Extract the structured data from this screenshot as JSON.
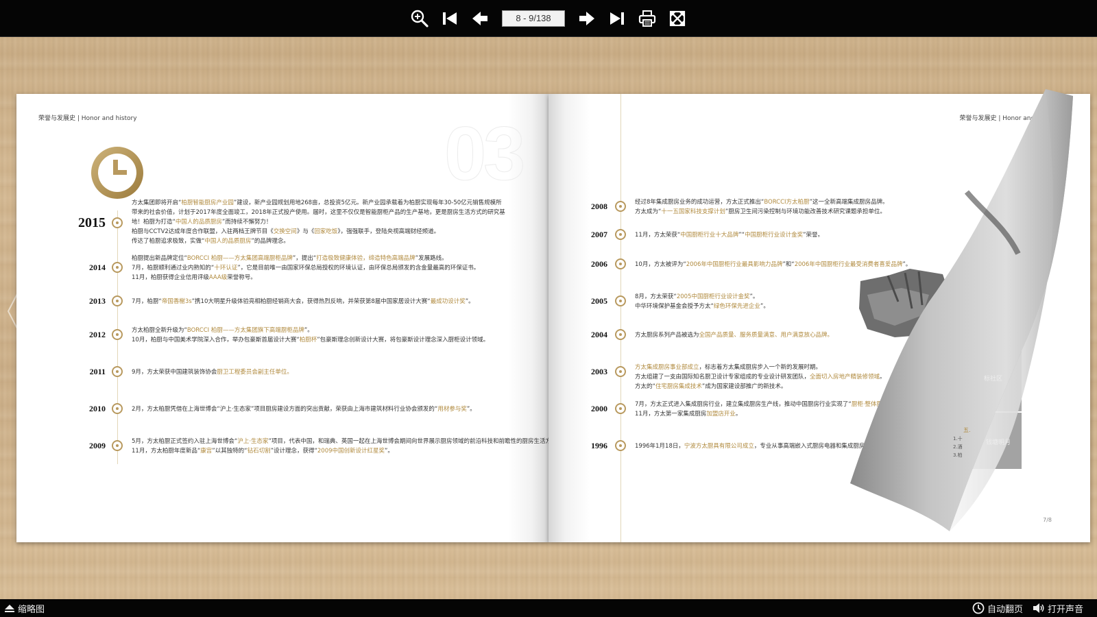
{
  "toolbar": {
    "page_indicator": "8 - 9/138",
    "icons": [
      "zoom-in-icon",
      "first-page-icon",
      "prev-page-icon",
      "next-page-icon",
      "last-page-icon",
      "print-icon",
      "fullscreen-icon"
    ]
  },
  "left_page": {
    "running_head": "荣誉与发展史 | Honor and history",
    "watermark": "03",
    "entries": [
      {
        "year": "2015",
        "lines": [
          [
            {
              "t": "方太集团即将开启“"
            },
            {
              "t": "柏厨智能厨房产业园",
              "g": true
            },
            {
              "t": "”建设，新产业园规划用地268亩，总投资5亿元。新产业园承载着为柏厨实现每年30-50亿元销售规模所"
            }
          ],
          [
            {
              "t": "带来的社会价值，计划于2017年度全面竣工，2018年正式投产使用。届时，这里不仅仅是智能厨柜产品的生产基地，更是厨房生活方式的研究基"
            }
          ],
          [
            {
              "t": "地！柏厨为打造“"
            },
            {
              "t": "中国人的品质厨房",
              "g": true
            },
            {
              "t": "”而持续不懈努力！"
            }
          ],
          [
            {
              "t": "柏厨与CCTV2达成年度合作联盟，入驻两档王牌节目《"
            },
            {
              "t": "交换空间",
              "g": true
            },
            {
              "t": "》与《"
            },
            {
              "t": "回家吃饭",
              "g": true
            },
            {
              "t": "》，强强联手，登陆央视高端财经频道。"
            }
          ],
          [
            {
              "t": "传达了柏厨追求极致，实做“"
            },
            {
              "t": "中国人的品质厨房",
              "g": true
            },
            {
              "t": "”的品牌理念。"
            }
          ]
        ]
      },
      {
        "year": "2014",
        "lines": [
          [
            {
              "t": "柏厨提出新品牌定位“"
            },
            {
              "t": "BORCCI 柏厨——方太集团高端厨柜品牌",
              "g": true
            },
            {
              "t": "”，提出“"
            },
            {
              "t": "打造极致健康体验，缔造特色高端品牌",
              "g": true
            },
            {
              "t": "”发展路线。"
            }
          ],
          [
            {
              "t": "7月，柏厨顺利通过业内熟知的“"
            },
            {
              "t": "十环认证",
              "g": true
            },
            {
              "t": "”，它是目前唯一由国家环保总局授权的环境认证，由环保总局颁发的含金量最高的环保证书。"
            }
          ],
          [
            {
              "t": "11月，柏厨获得企业信用评级"
            },
            {
              "t": "AAA级",
              "g": true
            },
            {
              "t": "荣誉称号。"
            }
          ]
        ]
      },
      {
        "year": "2013",
        "lines": [
          [
            {
              "t": "7月，柏厨“"
            },
            {
              "t": "帝国香榭3s",
              "g": true
            },
            {
              "t": "”携10大明星升级体验亮相柏厨经销商大会，获得热烈反响，并荣获第8届中国家居设计大赛“"
            },
            {
              "t": "最成功设计奖",
              "g": true
            },
            {
              "t": "”。"
            }
          ]
        ]
      },
      {
        "year": "2012",
        "lines": [
          [
            {
              "t": "方太柏厨全新升级为“"
            },
            {
              "t": "BORCCI 柏厨——方太集团旗下高端厨柜品牌",
              "g": true
            },
            {
              "t": "”。"
            }
          ],
          [
            {
              "t": "10月，柏厨与中国美术学院深入合作，举办包豪斯首届设计大赛“"
            },
            {
              "t": "柏厨杯",
              "g": true
            },
            {
              "t": "”包豪斯理念创新设计大赛，将包豪斯设计理念深入厨柜设计领域。"
            }
          ]
        ]
      },
      {
        "year": "2011",
        "lines": [
          [
            {
              "t": "9月，方太荣获中国建筑装饰协会"
            },
            {
              "t": "厨卫工程委员会副主任单位。",
              "g": true
            }
          ]
        ]
      },
      {
        "year": "2010",
        "lines": [
          [
            {
              "t": "2月，方太柏厨凭借在上海世博会“沪上·生态家”项目厨房建设方面的突出贡献，荣获由上海市建筑材料行业协会颁发的“"
            },
            {
              "t": "用材参与奖",
              "g": true
            },
            {
              "t": "”。"
            }
          ]
        ]
      },
      {
        "year": "2009",
        "lines": [
          [
            {
              "t": "5月，方太柏厨正式签约入驻上海世博会“"
            },
            {
              "t": "沪上·生态家",
              "g": true
            },
            {
              "t": "”项目，代表中国，和瑞典、英国一起在上海世博会期间向世界展示厨房领域的前沿科技和前瞻性的厨房生活方式。"
            }
          ],
          [
            {
              "t": "11月，方太柏厨年度新品“"
            },
            {
              "t": "康宫",
              "g": true
            },
            {
              "t": "”以其独特的“"
            },
            {
              "t": "钻石切割",
              "g": true
            },
            {
              "t": "”设计理念，获得“"
            },
            {
              "t": "2009中国创新设计红星奖",
              "g": true
            },
            {
              "t": "”。"
            }
          ]
        ]
      }
    ]
  },
  "right_page": {
    "running_head": "荣誉与发展史 | Honor and histo",
    "page_number": "7/8",
    "entries": [
      {
        "year": "2008",
        "lines": [
          [
            {
              "t": "经过8年集成厨房业务的成功运营，方太正式推出“"
            },
            {
              "t": "BORCCI方太柏厨",
              "g": true
            },
            {
              "t": "”这一全新高端集成厨房品牌。"
            }
          ],
          [
            {
              "t": "方太成为“"
            },
            {
              "t": "十一五国家科技支撑计划",
              "g": true
            },
            {
              "t": "”厨房卫生间污染控制与环境功能改善技术研究课题承担单位。"
            }
          ]
        ]
      },
      {
        "year": "2007",
        "lines": [
          [
            {
              "t": "11月，方太荣获“"
            },
            {
              "t": "中国厨柜行业十大品牌",
              "g": true
            },
            {
              "t": "”“"
            },
            {
              "t": "中国厨柜行业设计金奖",
              "g": true
            },
            {
              "t": "”荣誉。"
            }
          ]
        ]
      },
      {
        "year": "2006",
        "lines": [
          [
            {
              "t": "10月，方太被评为“"
            },
            {
              "t": "2006年中国厨柜行业最具影响力品牌",
              "g": true
            },
            {
              "t": "”和“"
            },
            {
              "t": "2006年中国厨柜行业最受消费者喜爱品牌",
              "g": true
            },
            {
              "t": "”。"
            }
          ]
        ]
      },
      {
        "year": "2005",
        "lines": [
          [
            {
              "t": "8月，方太荣获“"
            },
            {
              "t": "2005中国厨柜行业设计金奖",
              "g": true
            },
            {
              "t": "”。"
            }
          ],
          [
            {
              "t": "中华环境保护基金会授予方太“"
            },
            {
              "t": "绿色环保先进企业",
              "g": true
            },
            {
              "t": "”。"
            }
          ]
        ]
      },
      {
        "year": "2004",
        "lines": [
          [
            {
              "t": "方太厨房系列产品被选为"
            },
            {
              "t": "全国产品质量、服务质量满意、用户满意放心品牌。",
              "g": true
            }
          ]
        ]
      },
      {
        "year": "2003",
        "lines": [
          [
            {
              "t": "方太集成厨房事业部成立",
              "g": true
            },
            {
              "t": "，标志着方太集成厨房步入一个新的发展时期。"
            }
          ],
          [
            {
              "t": "方太组建了一支由国际知名厨卫设计专家组成的专业设计研发团队，"
            },
            {
              "t": "全面切入房地产精装修领域",
              "g": true
            },
            {
              "t": "。"
            }
          ],
          [
            {
              "t": "方太的“"
            },
            {
              "t": "住宅厨房集成技术",
              "g": true
            },
            {
              "t": "”成为国家建设部推广的新技术。"
            }
          ]
        ]
      },
      {
        "year": "2000",
        "lines": [
          [
            {
              "t": "7月，方太正式进入集成厨房行业，建立集成厨房生产线，推动中国厨房行业实现了“"
            },
            {
              "t": "厨柜·整体厨房",
              "g": true
            },
            {
              "t": "”"
            }
          ],
          [
            {
              "t": "11月，方太第一家集成厨房"
            },
            {
              "t": "加盟店开业",
              "g": true
            },
            {
              "t": "。"
            }
          ]
        ]
      },
      {
        "year": "1996",
        "lines": [
          [
            {
              "t": "1996年1月18日，"
            },
            {
              "t": "宁波方太厨具有限公司成立",
              "g": true
            },
            {
              "t": "，专业从事高端嵌入式厨房电器和集成厨房"
            }
          ]
        ]
      }
    ]
  },
  "curl_page": {
    "labels": [
      "标社区",
      "钱塘明月"
    ],
    "snippet_lines": [
      "五.",
      "1.十",
      "2.酒",
      "3.柏"
    ]
  },
  "bottombar": {
    "thumbnails_label": "缩略图",
    "auto_flip_label": "自动翻页",
    "sound_label": "打开声音"
  },
  "colors": {
    "gold": "#b08a3e",
    "toolbar_bg": "#050505",
    "wood": "#d4b891"
  }
}
